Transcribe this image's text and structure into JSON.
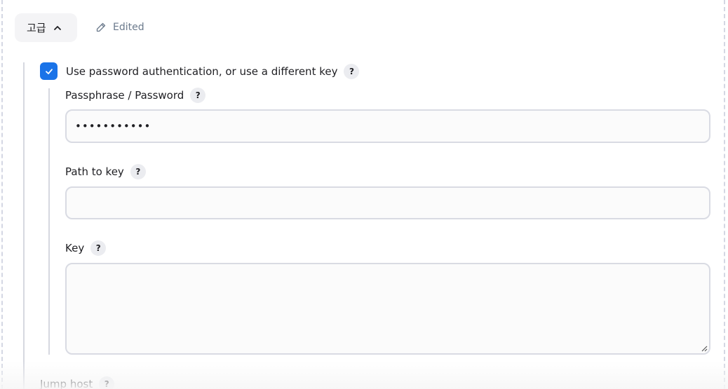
{
  "advanced": {
    "label": "고급",
    "icon": "chevron-up-icon",
    "edited_label": "Edited",
    "edited_icon": "pencil-icon"
  },
  "auth": {
    "checkbox_checked": true,
    "checkbox_label": "Use password authentication, or use a different key",
    "help": "?"
  },
  "fields": {
    "passphrase": {
      "label": "Passphrase / Password",
      "value": "•••••••••••",
      "help": "?"
    },
    "path_to_key": {
      "label": "Path to key",
      "value": "",
      "help": "?"
    },
    "key": {
      "label": "Key",
      "value": "",
      "help": "?"
    }
  },
  "jump_host": {
    "label": "Jump host",
    "help": "?"
  },
  "colors": {
    "accent": "#1a73e8",
    "border": "#d9dbe3",
    "muted_text": "#6b7a8c"
  }
}
